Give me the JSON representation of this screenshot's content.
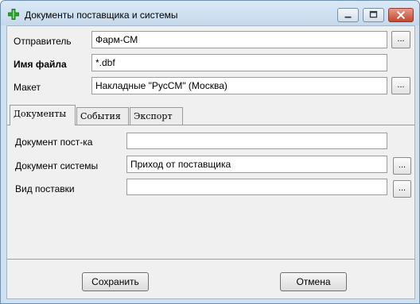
{
  "window": {
    "title": "Документы поставщика и системы",
    "icon": "green-cross-icon",
    "controls": {
      "minimize": "minimize-icon",
      "maximize": "maximize-icon",
      "close": "close-icon"
    }
  },
  "form": {
    "sender_label": "Отправитель",
    "sender_value": "Фарм-СМ",
    "filename_label": "Имя файла",
    "filename_value": "*.dbf",
    "layout_label": "Макет",
    "layout_value": "Накладные \"РусСМ\" (Москва)",
    "browse_label": "..."
  },
  "tabs": [
    {
      "label": "Документы",
      "active": true
    },
    {
      "label": "События",
      "active": false
    },
    {
      "label": "Экспорт",
      "active": false
    }
  ],
  "documents_tab": {
    "supplier_doc_label": "Документ пост-ка",
    "supplier_doc_value": "",
    "system_doc_label": "Документ системы",
    "system_doc_value": "Приход от поставщика",
    "delivery_type_label": "Вид поставки",
    "delivery_type_value": ""
  },
  "buttons": {
    "save": "Сохранить",
    "cancel": "Отмена"
  },
  "colors": {
    "title_bar": "#c5d9ec",
    "close_button": "#c6452e",
    "client_background": "#f0f0f0",
    "icon_green": "#2aa52a"
  }
}
